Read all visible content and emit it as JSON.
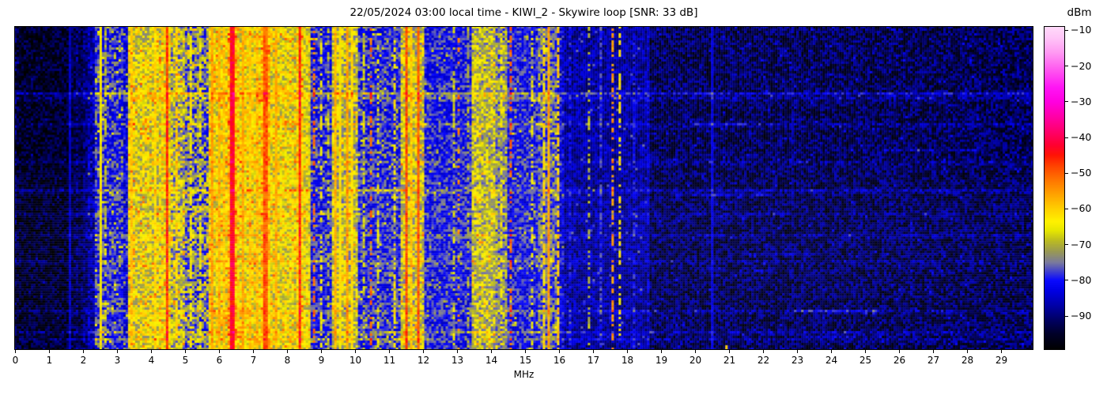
{
  "title": "22/05/2024 03:00 local time - KIWI_2 - Skywire loop [SNR: 33 dB]",
  "xaxis": {
    "label": "MHz",
    "ticks": [
      0,
      1,
      2,
      3,
      4,
      5,
      6,
      7,
      8,
      9,
      10,
      11,
      12,
      13,
      14,
      15,
      16,
      17,
      18,
      19,
      20,
      21,
      22,
      23,
      24,
      25,
      26,
      27,
      28,
      29
    ]
  },
  "colorbar": {
    "label": "dBm",
    "ticks": [
      {
        "value": -10,
        "label": "−10"
      },
      {
        "value": -20,
        "label": "−20"
      },
      {
        "value": -30,
        "label": "−30"
      },
      {
        "value": -40,
        "label": "−40"
      },
      {
        "value": -50,
        "label": "−50"
      },
      {
        "value": -60,
        "label": "−60"
      },
      {
        "value": -70,
        "label": "−70"
      },
      {
        "value": -80,
        "label": "−80"
      },
      {
        "value": -90,
        "label": "−90"
      }
    ]
  },
  "chart_data": {
    "type": "heatmap",
    "title": "22/05/2024 03:00 local time - KIWI_2 - Skywire loop [SNR: 33 dB]",
    "xlabel": "MHz",
    "x_range_mhz": [
      0,
      30
    ],
    "snr_db": 33,
    "colorbar_label": "dBm",
    "colorbar_range_dbm": [
      -99.5,
      -8.8
    ],
    "colorbar_ticks_dbm": [
      -10,
      -20,
      -30,
      -40,
      -50,
      -60,
      -70,
      -80,
      -90
    ],
    "legend_position": "right",
    "grid": false,
    "description": "HF waterfall: quiet black below 1.5 MHz; carrier at 2.05 MHz; dense yellow/orange/red broadcast activity 3-8.7 MHz peaking red at 6.4 MHz; alternating blue and yellow bands 9-14 MHz; red carriers near 10.0, 11.5, 13.7, 15.0 MHz; bright yellow pair near 15.5-15.8 MHz; sparse dark blue noise 16-18.6 MHz; near-empty dark noise 18.6-30 MHz with faint line at 20.5 MHz and small mark at 20.9 MHz",
    "colormap_stops": [
      [
        -99.5,
        "#000000"
      ],
      [
        -95,
        "#00002a"
      ],
      [
        -91,
        "#000066"
      ],
      [
        -87,
        "#0000aa"
      ],
      [
        -83,
        "#0000e4"
      ],
      [
        -80,
        "#0b0bff"
      ],
      [
        -77.5,
        "#4444cc"
      ],
      [
        -75,
        "#7c7c9c"
      ],
      [
        -72,
        "#999955"
      ],
      [
        -69,
        "#bbbb22"
      ],
      [
        -66,
        "#e8e800"
      ],
      [
        -63.5,
        "#fff200"
      ],
      [
        -60,
        "#ffd000"
      ],
      [
        -56,
        "#ffa400"
      ],
      [
        -52,
        "#ff7700"
      ],
      [
        -48,
        "#ff4400"
      ],
      [
        -45,
        "#ff1505"
      ],
      [
        -42,
        "#ff0033"
      ],
      [
        -38,
        "#ff0070"
      ],
      [
        -34,
        "#ff00aa"
      ],
      [
        -30,
        "#ff00e0"
      ],
      [
        -26,
        "#ff15f5"
      ],
      [
        -21,
        "#ff58f0"
      ],
      [
        -16,
        "#ff9cf3"
      ],
      [
        -12,
        "#ffc6f8"
      ],
      [
        -8.8,
        "#ffdcfa"
      ]
    ],
    "bands": [
      [
        0,
        1.55,
        -95,
        5.5,
        0.015,
        -88
      ],
      [
        1.55,
        1.7,
        -93,
        5,
        0,
        0
      ],
      [
        1.7,
        2.0,
        -93,
        5,
        0.02,
        -87
      ],
      [
        2.0,
        2.12,
        -90,
        5,
        0,
        0
      ],
      [
        2.12,
        2.35,
        -87,
        6,
        0.03,
        -75
      ],
      [
        2.35,
        3.15,
        -79,
        7,
        0.05,
        -66
      ],
      [
        3.15,
        3.3,
        -82,
        6,
        0.03,
        -70
      ],
      [
        3.3,
        4.3,
        -66,
        8,
        0.06,
        -52
      ],
      [
        4.3,
        4.6,
        -64,
        8,
        0.05,
        -52
      ],
      [
        4.6,
        5.0,
        -70,
        9,
        0.05,
        -55
      ],
      [
        5.0,
        5.7,
        -75,
        9,
        0.06,
        -60
      ],
      [
        5.7,
        6.25,
        -64,
        8,
        0.05,
        -52
      ],
      [
        6.25,
        6.55,
        -58,
        7,
        0.05,
        -48
      ],
      [
        6.55,
        7.2,
        -64,
        8,
        0.05,
        -52
      ],
      [
        7.2,
        7.5,
        -60,
        7,
        0.06,
        -50
      ],
      [
        7.5,
        8.25,
        -65,
        8,
        0.05,
        -53
      ],
      [
        8.25,
        8.5,
        -62,
        7,
        0.05,
        -50
      ],
      [
        8.5,
        8.65,
        -66,
        7,
        0.04,
        -55
      ],
      [
        8.65,
        9.3,
        -80,
        6,
        0.04,
        -68
      ],
      [
        9.3,
        10.05,
        -69,
        8,
        0.05,
        -56
      ],
      [
        10.05,
        11.35,
        -79,
        6,
        0.05,
        -68
      ],
      [
        11.35,
        12.0,
        -68,
        8,
        0.05,
        -55
      ],
      [
        12.0,
        13.45,
        -80,
        6,
        0.04,
        -70
      ],
      [
        13.45,
        14.15,
        -69,
        8,
        0.04,
        -56
      ],
      [
        14.15,
        14.45,
        -73,
        7,
        0.04,
        -62
      ],
      [
        14.45,
        15.35,
        -80,
        6,
        0.03,
        -68
      ],
      [
        15.35,
        15.9,
        -76,
        7,
        0.04,
        -64
      ],
      [
        15.9,
        16.15,
        -83,
        6,
        0.03,
        -72
      ],
      [
        16.15,
        18.55,
        -87.5,
        5.5,
        0.02,
        -78
      ],
      [
        18.55,
        18.65,
        -85,
        5,
        0,
        0
      ],
      [
        18.65,
        29.98,
        -92,
        6.5,
        0.02,
        -83
      ]
    ],
    "carriers": [
      {
        "f": 1.62,
        "l": -85,
        "w": 0.018
      },
      {
        "f": 1.8,
        "l": -88,
        "p": 0.5
      },
      {
        "f": 2.05,
        "l": -59,
        "w": 0.026
      },
      {
        "f": 2.5,
        "l": -64
      },
      {
        "f": 2.65,
        "l": -70,
        "p": 0.6
      },
      {
        "f": 2.82,
        "l": -66
      },
      {
        "f": 2.95,
        "l": -62
      },
      {
        "f": 3.1,
        "l": -67,
        "p": 0.7
      },
      {
        "f": 3.4,
        "l": -60
      },
      {
        "f": 3.6,
        "l": -62
      },
      {
        "f": 3.8,
        "l": -58
      },
      {
        "f": 3.95,
        "l": -55
      },
      {
        "f": 4.1,
        "l": -62
      },
      {
        "f": 4.45,
        "l": -47,
        "w": 0.05,
        "a": 4
      },
      {
        "f": 4.75,
        "l": -60,
        "p": 0.7
      },
      {
        "f": 5.15,
        "l": -64,
        "p": 0.7
      },
      {
        "f": 5.45,
        "l": -66,
        "p": 0.6
      },
      {
        "f": 5.8,
        "l": -56
      },
      {
        "f": 6.0,
        "l": -58
      },
      {
        "f": 6.15,
        "l": -60
      },
      {
        "f": 6.38,
        "l": -43,
        "w": 0.085,
        "a": 4
      },
      {
        "f": 6.7,
        "l": -57
      },
      {
        "f": 6.9,
        "l": -60
      },
      {
        "f": 7.1,
        "l": -59
      },
      {
        "f": 7.35,
        "l": -50,
        "w": 0.07,
        "a": 4
      },
      {
        "f": 7.65,
        "l": -58
      },
      {
        "f": 7.85,
        "l": -61
      },
      {
        "f": 8.05,
        "l": -57
      },
      {
        "f": 8.2,
        "l": -52
      },
      {
        "f": 8.37,
        "l": -46,
        "w": 0.04,
        "a": 4
      },
      {
        "f": 8.78,
        "l": -52,
        "p": 0.45
      },
      {
        "f": 9.0,
        "l": -65,
        "p": 0.5
      },
      {
        "f": 9.2,
        "l": -70,
        "p": 0.4
      },
      {
        "f": 9.4,
        "l": -58
      },
      {
        "f": 9.55,
        "l": -63
      },
      {
        "f": 9.75,
        "l": -56
      },
      {
        "f": 9.9,
        "l": -62
      },
      {
        "f": 10.0,
        "l": -47,
        "w": 0.02,
        "a": 4
      },
      {
        "f": 10.25,
        "l": -68,
        "p": 0.5
      },
      {
        "f": 10.45,
        "l": -51,
        "p": 0.4
      },
      {
        "f": 10.65,
        "l": -66,
        "p": 0.5
      },
      {
        "f": 10.9,
        "l": -64,
        "p": 0.6
      },
      {
        "f": 11.15,
        "l": -63,
        "p": 0.6
      },
      {
        "f": 11.5,
        "l": -49,
        "w": 0.02
      },
      {
        "f": 11.65,
        "l": -60
      },
      {
        "f": 11.85,
        "l": -50,
        "w": 0.02
      },
      {
        "f": 12.3,
        "l": -72,
        "p": 0.4
      },
      {
        "f": 12.65,
        "l": -53,
        "p": 0.35
      },
      {
        "f": 12.9,
        "l": -68,
        "p": 0.4
      },
      {
        "f": 13.05,
        "l": -54,
        "p": 0.3
      },
      {
        "f": 13.3,
        "l": -70,
        "p": 0.4
      },
      {
        "f": 13.55,
        "l": -60
      },
      {
        "f": 13.7,
        "l": -47,
        "w": 0.03,
        "a": 4
      },
      {
        "f": 13.9,
        "l": -58
      },
      {
        "f": 14.05,
        "l": -62
      },
      {
        "f": 14.3,
        "l": -64,
        "p": 0.5
      },
      {
        "f": 14.55,
        "l": -50,
        "p": 0.5
      },
      {
        "f": 14.95,
        "l": -47,
        "w": 0.02
      },
      {
        "f": 15.02,
        "l": -58,
        "w": 0.03
      },
      {
        "f": 15.1,
        "l": -64,
        "p": 0.6
      },
      {
        "f": 15.2,
        "l": -66,
        "p": 0.5
      },
      {
        "f": 15.3,
        "l": -64,
        "p": 0.5
      },
      {
        "f": 15.45,
        "l": -62
      },
      {
        "f": 15.55,
        "l": -62,
        "p": 0.7
      },
      {
        "f": 15.7,
        "l": -56,
        "w": 0.055
      },
      {
        "f": 15.95,
        "l": -60,
        "p": 0.75
      },
      {
        "f": 16.3,
        "l": -80,
        "p": 0.6
      },
      {
        "f": 16.55,
        "l": -81,
        "p": 0.6
      },
      {
        "f": 16.85,
        "l": -70,
        "p": 0.4
      },
      {
        "f": 17.05,
        "l": -76,
        "p": 0.5
      },
      {
        "f": 17.2,
        "l": -78,
        "p": 0.6
      },
      {
        "f": 17.57,
        "l": -55,
        "p": 0.55
      },
      {
        "f": 17.78,
        "l": -63,
        "p": 0.5
      },
      {
        "f": 17.95,
        "l": -74,
        "p": 0.5
      },
      {
        "f": 18.2,
        "l": -80,
        "p": 0.5
      },
      {
        "f": 18.58,
        "l": -76,
        "w": 0.02
      },
      {
        "f": 20.5,
        "l": -83,
        "w": 0.02,
        "a": 2
      },
      {
        "f": 22.85,
        "l": -88,
        "p": 0.5
      }
    ],
    "streaks": [
      {
        "y": 0.205,
        "b": 8
      },
      {
        "y": 0.218,
        "b": 4
      },
      {
        "y": 0.3,
        "b": 4
      },
      {
        "y": 0.415,
        "b": 3
      },
      {
        "y": 0.5,
        "b": 5
      },
      {
        "y": 0.575,
        "b": 3
      },
      {
        "y": 0.64,
        "b": 4
      },
      {
        "y": 0.72,
        "b": 3
      },
      {
        "y": 0.875,
        "b": 4
      },
      {
        "y": 0.94,
        "b": 5
      },
      {
        "y": 0.965,
        "b": 4
      }
    ],
    "segments": [
      {
        "f0": 19.3,
        "f1": 22.3,
        "y": 0.52,
        "b": 7
      },
      {
        "f0": 23.1,
        "f1": 25.4,
        "y": 0.875,
        "b": 8
      },
      {
        "f0": 23.1,
        "f1": 24.7,
        "y": 0.955,
        "b": 8
      },
      {
        "f0": 20.0,
        "f1": 21.5,
        "y": 0.3,
        "b": 6
      },
      {
        "f0": 25.5,
        "f1": 28.5,
        "y": 0.38,
        "b": 5
      },
      {
        "f0": 9.8,
        "f1": 11.5,
        "y": 0.5,
        "b": 6
      },
      {
        "f0": 21.5,
        "f1": 23.3,
        "y": 0.7,
        "b": 6
      }
    ],
    "bottom_marks": [
      {
        "f": 20.9,
        "w": 0.05,
        "l": -60,
        "rows": 2
      }
    ]
  }
}
